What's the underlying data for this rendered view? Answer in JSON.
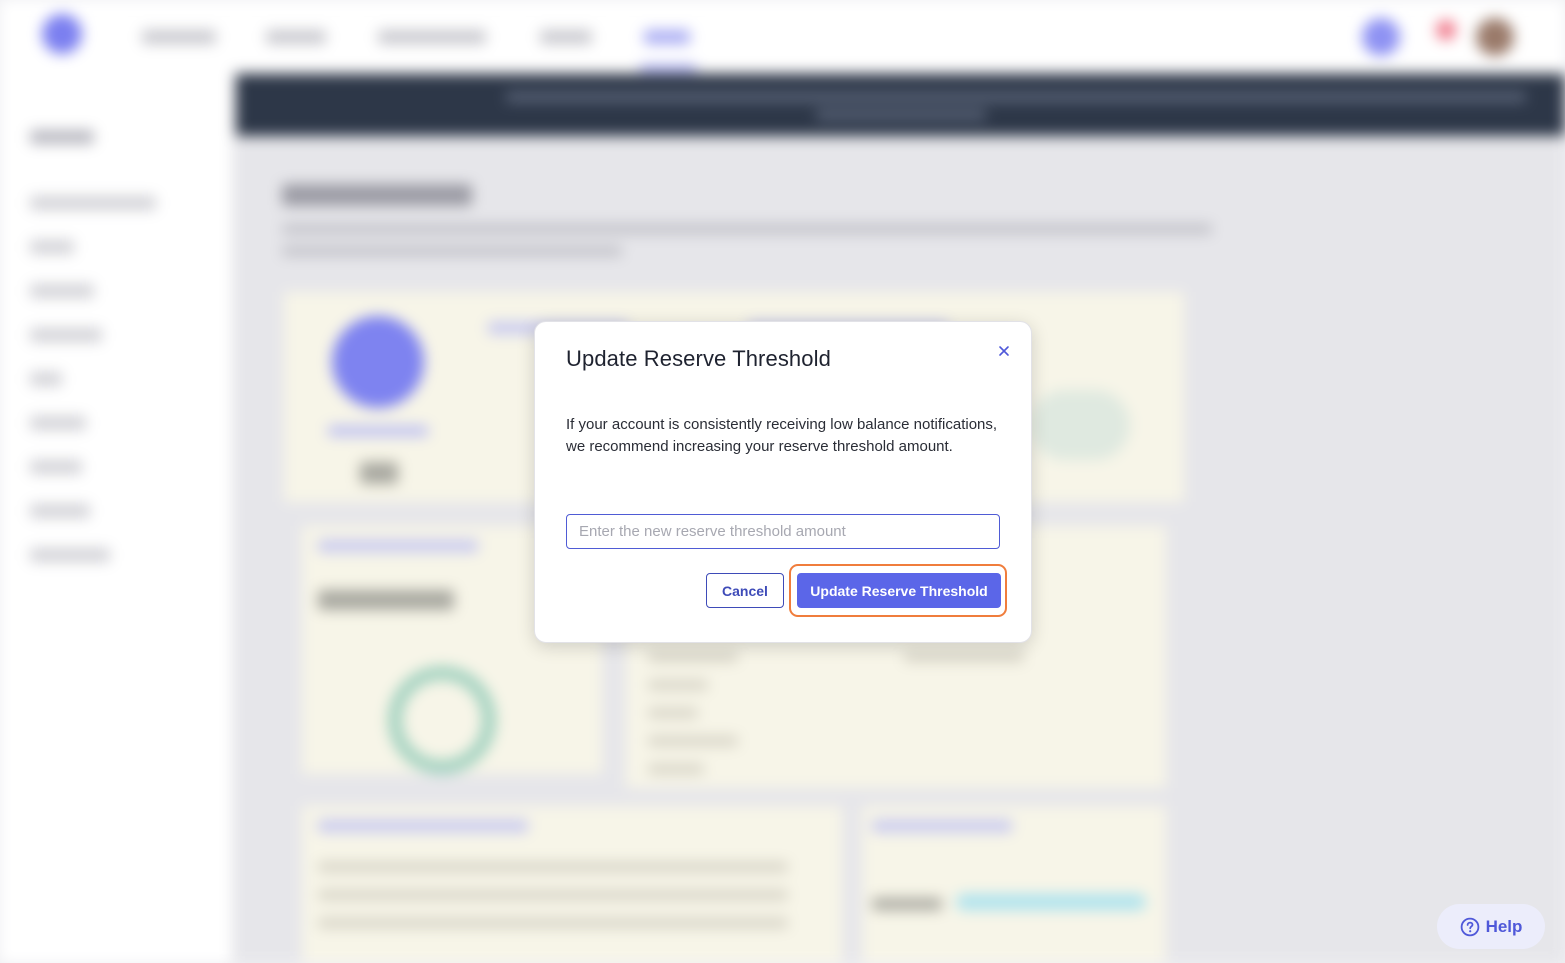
{
  "modal": {
    "title": "Update Reserve Threshold",
    "body": "If your account is consistently receiving low balance notifications, we recommend increasing your reserve threshold amount.",
    "input_placeholder": "Enter the new reserve threshold amount",
    "input_value": "",
    "cancel_label": "Cancel",
    "submit_label": "Update Reserve Threshold",
    "close_icon": "close-icon"
  },
  "help": {
    "label": "Help",
    "icon": "question-circle-icon"
  },
  "colors": {
    "accent": "#5b66e8",
    "focus_ring": "#f07d3c",
    "banner": "#2d3748"
  }
}
